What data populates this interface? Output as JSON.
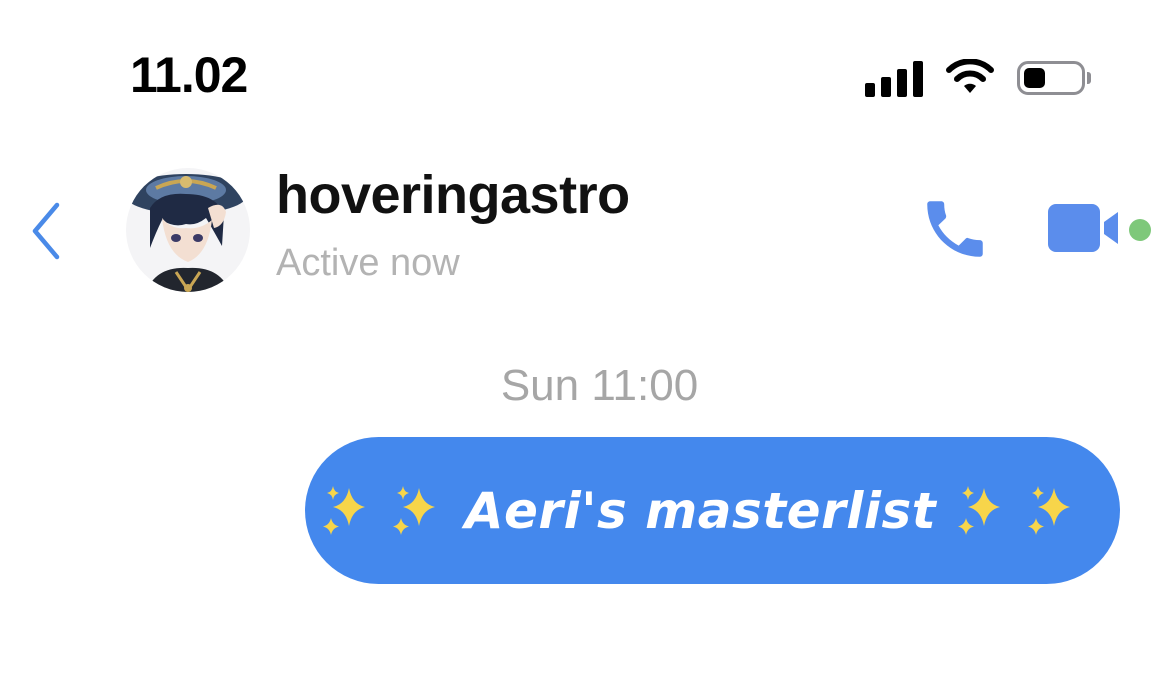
{
  "status_bar": {
    "time": "11.02",
    "icons": [
      "cellular-signal-icon",
      "wifi-icon",
      "battery-icon"
    ],
    "battery_level": 0.35
  },
  "header": {
    "contact_name": "hoveringastro",
    "presence": "Active now",
    "icons": [
      "back-chevron-icon",
      "phone-icon",
      "video-camera-icon"
    ],
    "active_indicator_color": "#7ec87a"
  },
  "conversation": {
    "timestamp": "Sun 11:00",
    "messages": [
      {
        "direction": "outgoing",
        "text": "Aeri's masterlist",
        "decorations": "sparkles-icon x2 on each side",
        "bubble_color": "#4488ed"
      }
    ]
  },
  "colors": {
    "accent": "#4488ed",
    "icon_blue": "#5b8dec",
    "muted_text": "#b3b3b3"
  }
}
